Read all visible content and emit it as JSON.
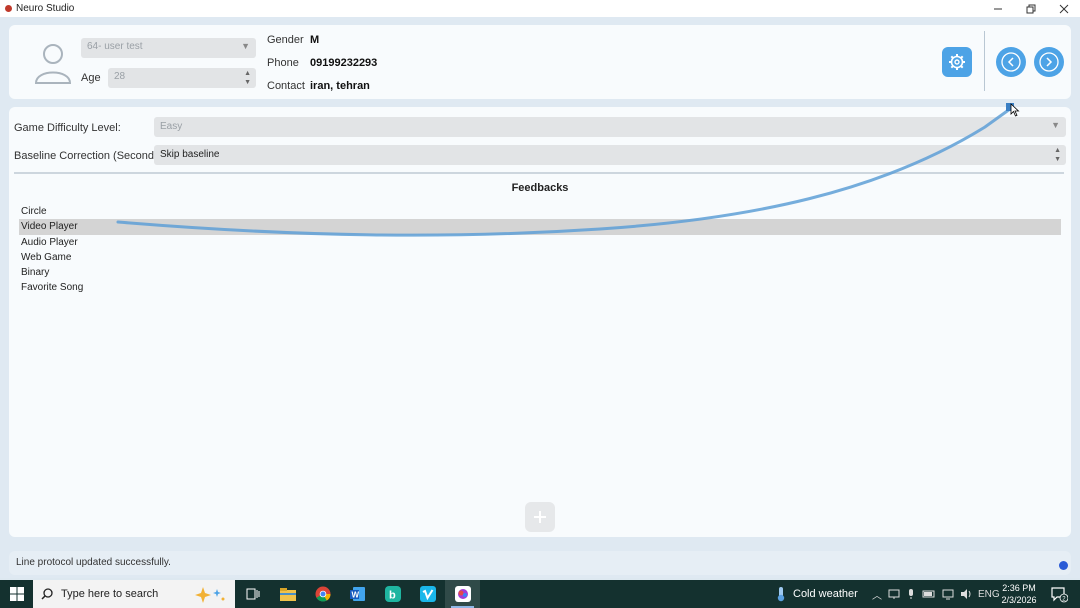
{
  "window": {
    "title": "Neuro Studio",
    "controls": [
      "minimize",
      "maximize",
      "close"
    ]
  },
  "profile": {
    "user_select": "64- user test",
    "age_label": "Age",
    "age_value": "28",
    "gender_label": "Gender",
    "gender_value": "M",
    "phone_label": "Phone",
    "phone_value": "09199232293",
    "contact_label": "Contact",
    "contact_value": "iran, tehran"
  },
  "toolbar": {
    "icons": [
      "gear-icon",
      "chevron-left-icon",
      "chevron-right-icon"
    ]
  },
  "settings": {
    "difficulty_label": "Game Difficulty Level:",
    "difficulty_value": "Easy",
    "baseline_label": "Baseline Correction (Seconds):",
    "baseline_value": "Skip baseline"
  },
  "feedbacks": {
    "title": "Feedbacks",
    "items": [
      "Circle",
      "Video Player",
      "Audio Player",
      "Web Game",
      "Binary",
      "Favorite Song"
    ],
    "selected": "Video Player"
  },
  "status": {
    "message": "Line protocol updated successfully."
  },
  "taskbar": {
    "search_placeholder": "Type here to search",
    "apps": [
      "task-view-icon",
      "file-explorer-icon",
      "chrome-icon",
      "word-icon",
      "bing-icon",
      "vimeo-icon",
      "neuro-studio-icon"
    ],
    "weather": "Cold weather",
    "language": "ENG",
    "time": "2:36 PM",
    "date": "2/3/2026",
    "notification_count": "2"
  },
  "colors": {
    "accent": "#4da3e6",
    "selection": "#d4d4d4",
    "taskbar": "#14312f"
  }
}
